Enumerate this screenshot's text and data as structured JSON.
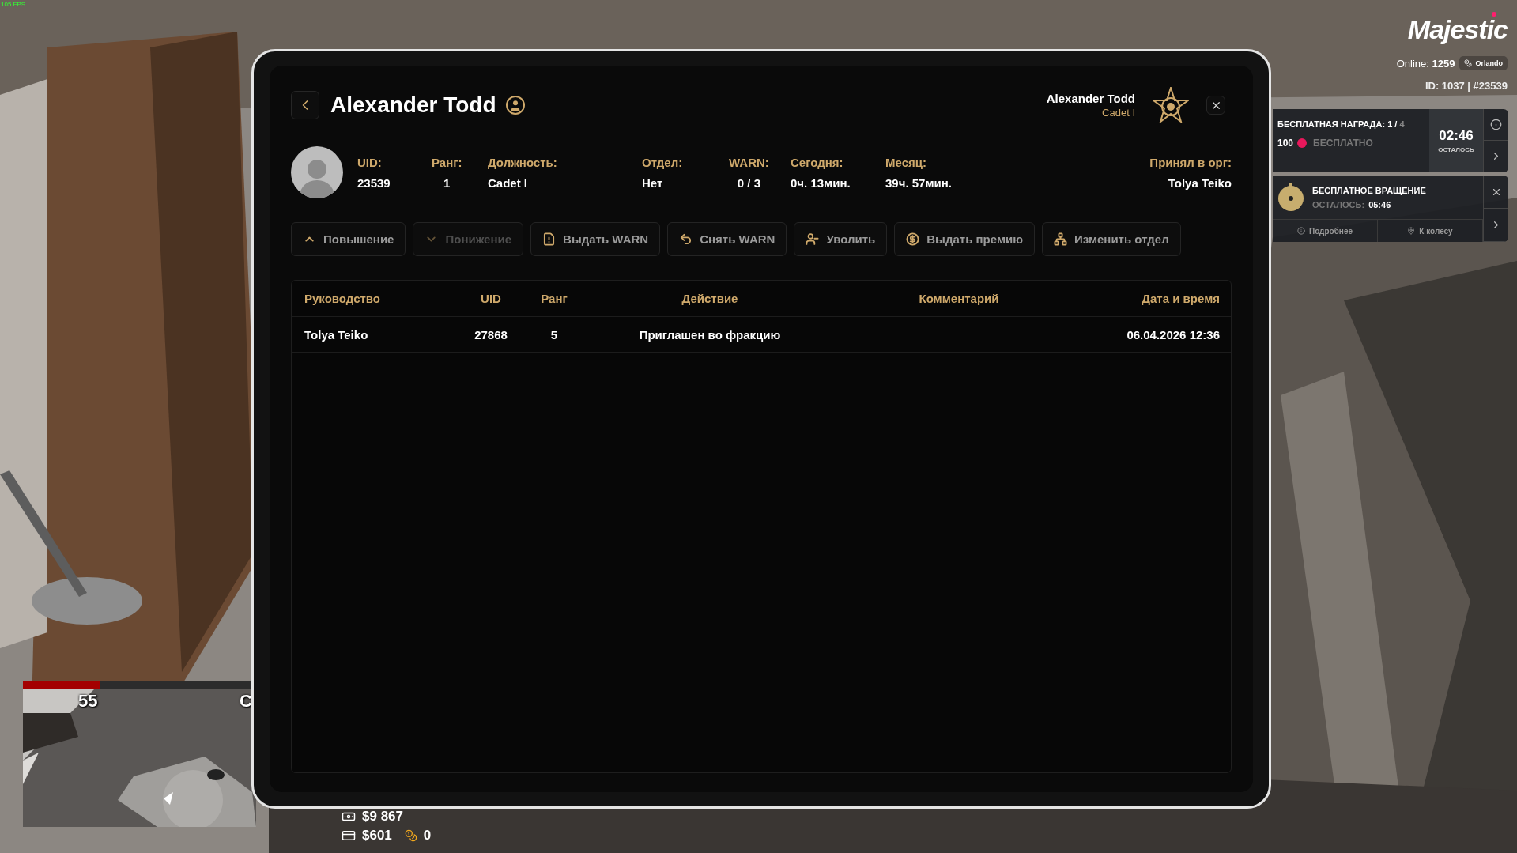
{
  "hud": {
    "fps": "105 FPS",
    "logo": "Majestic",
    "online_label": "Online:",
    "online": "1259",
    "server": "Orlando",
    "id": "ID: 1037 | #23539"
  },
  "reward": {
    "title": "БЕСПЛАТНАЯ НАГРАДА:",
    "progress": "1 /",
    "total": "4",
    "amount": "100",
    "status": "БЕСПЛАТНО",
    "timer": "02:46",
    "timer_label": "ОСТАЛОСЬ"
  },
  "spin": {
    "title": "БЕСПЛАТНОЕ ВРАЩЕНИЕ",
    "remaining_label": "ОСТАЛОСЬ:",
    "remaining": "05:46",
    "links": [
      {
        "label": "Подробнее",
        "kind": "info"
      },
      {
        "label": "К колесу",
        "kind": "pin"
      }
    ]
  },
  "minimap": {
    "health": {
      "level": 0.33
    },
    "speed": "55",
    "column_2": "C"
  },
  "money": {
    "bank": "$9 867",
    "cash": "$601",
    "chips": "0"
  },
  "tablet": {
    "title": "Alexander Todd",
    "user": {
      "name": "Alexander Todd",
      "rank": "Cadet I"
    },
    "fields": [
      {
        "label": "UID:",
        "value": "23539"
      },
      {
        "label": "Ранг:",
        "value": "1"
      },
      {
        "label": "Должность:",
        "value": "Cadet I"
      },
      {
        "label": "Отдел:",
        "value": "Нет"
      },
      {
        "label": "WARN:",
        "value": "0 / 3"
      },
      {
        "label": "Сегодня:",
        "value": "0ч. 13мин."
      },
      {
        "label": "Месяц:",
        "value": "39ч. 57мин."
      }
    ],
    "accepted": {
      "label": "Принял в орг:",
      "value": "Tolya Teiko"
    },
    "actions": [
      {
        "label": "Повышение",
        "kind": "up",
        "disabled": false
      },
      {
        "label": "Понижение",
        "kind": "down",
        "disabled": true
      },
      {
        "label": "Выдать WARN",
        "kind": "warn",
        "disabled": false
      },
      {
        "label": "Снять WARN",
        "kind": "undo",
        "disabled": false
      },
      {
        "label": "Уволить",
        "kind": "fire",
        "disabled": false
      },
      {
        "label": "Выдать премию",
        "kind": "bonus",
        "disabled": false
      },
      {
        "label": "Изменить отдел",
        "kind": "dept",
        "disabled": false
      }
    ],
    "table": {
      "columns": [
        "Руководство",
        "UID",
        "Ранг",
        "Действие",
        "Комментарий",
        "Дата и время"
      ],
      "rows": [
        [
          "Tolya Teiko",
          "27868",
          "5",
          "Приглашен во фракцию",
          "",
          "06.04.2026 12:36"
        ]
      ]
    }
  }
}
